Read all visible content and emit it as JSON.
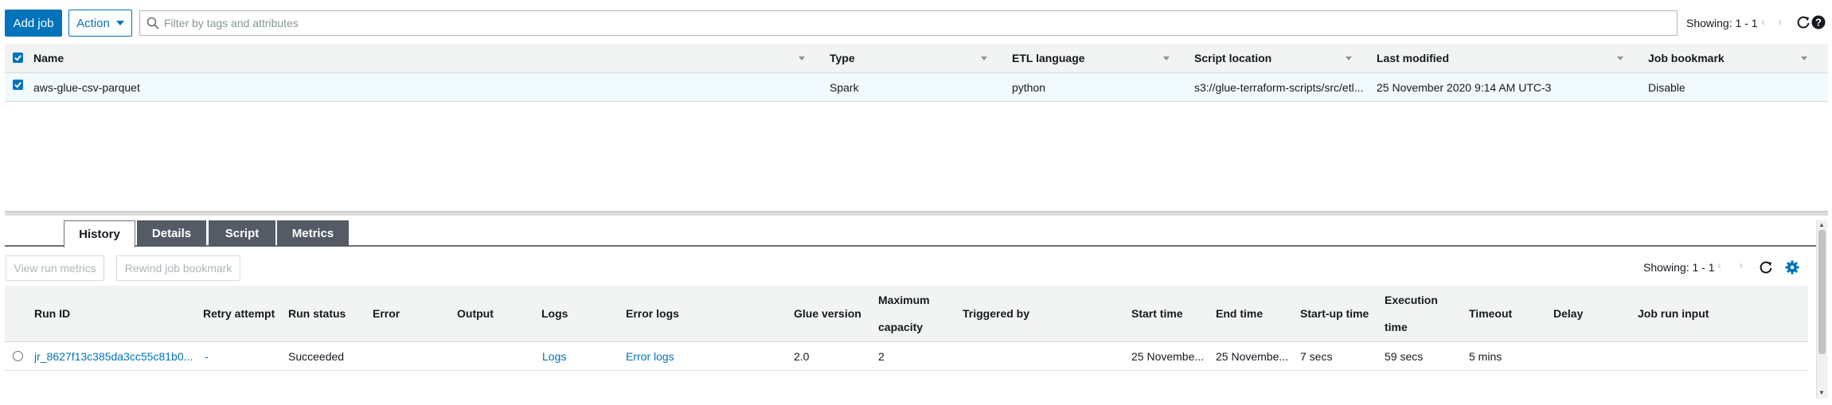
{
  "toolbar": {
    "add_job_label": "Add job",
    "action_label": "Action",
    "search_placeholder": "Filter by tags and attributes",
    "showing": "Showing: 1 - 1"
  },
  "jobs_table": {
    "columns": [
      "Name",
      "Type",
      "ETL language",
      "Script location",
      "Last modified",
      "Job bookmark"
    ],
    "rows": [
      {
        "name": "aws-glue-csv-parquet",
        "type": "Spark",
        "etl_language": "python",
        "script_location": "s3://glue-terraform-scripts/src/etl...",
        "last_modified": "25 November 2020 9:14 AM UTC-3",
        "job_bookmark": "Disable",
        "selected": true
      }
    ]
  },
  "detail_panel": {
    "tabs": [
      "History",
      "Details",
      "Script",
      "Metrics"
    ],
    "active_tab": "History",
    "view_run_metrics_label": "View run metrics",
    "rewind_bookmark_label": "Rewind job bookmark",
    "showing": "Showing: 1 - 1"
  },
  "runs_table": {
    "columns": [
      "Run ID",
      "Retry attempt",
      "Run status",
      "Error",
      "Output",
      "Logs",
      "Error logs",
      "Glue version",
      "Maximum capacity",
      "Triggered by",
      "Start time",
      "End time",
      "Start-up time",
      "Execution time",
      "Timeout",
      "Delay",
      "Job run input"
    ],
    "rows": [
      {
        "run_id": "jr_8627f13c385da3cc55c81b0...",
        "retry_attempt": "-",
        "run_status": "Succeeded",
        "error": "",
        "output": "",
        "logs": "Logs",
        "error_logs": "Error logs",
        "glue_version": "2.0",
        "max_capacity": "2",
        "triggered_by": "",
        "start_time": "25 Novembe...",
        "end_time": "25 Novembe...",
        "startup_time": "7 secs",
        "execution_time": "59 secs",
        "timeout": "5 mins",
        "delay": "",
        "job_run_input": ""
      }
    ]
  },
  "colors": {
    "accent": "#0073bb",
    "selected_row": "#f1faff",
    "header_bg": "#f2f3f3",
    "tab_inactive": "#545b64"
  }
}
